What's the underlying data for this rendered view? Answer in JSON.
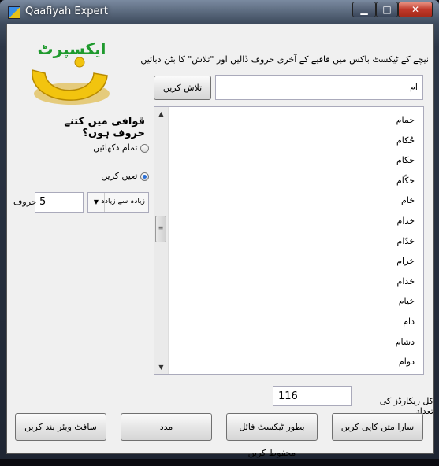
{
  "window": {
    "title": "Qaafiyah Expert",
    "controls": {
      "minimize": "▁",
      "maximize": "□",
      "close": "✕"
    }
  },
  "logo": {
    "text": "ایکسپرٹ",
    "colors": {
      "gold": "#f2c40f",
      "green": "#1f9a2e"
    }
  },
  "instruction": "نیچے کے ٹیکسٹ باکس میں قافیے کے آخری حروف ڈالیں اور \"تلاش\" کا بٹن دبائیں",
  "search": {
    "value": "ام",
    "button_label": "تلاش کریں"
  },
  "options": {
    "question": "قوافی میں کتنے حروف ہوں؟",
    "radio_all": {
      "label": "تمام دکھائیں",
      "checked": false
    },
    "radio_fixed": {
      "label": "تعین کریں",
      "checked": true
    },
    "dropdown_value": "زیادہ سے زیادہ",
    "count_value": "5",
    "count_unit": "حروف"
  },
  "results": {
    "items": [
      "حمام",
      "حُکام",
      "حکام",
      "حکّام",
      "خام",
      "خدام",
      "خدّام",
      "خرام",
      "خدام",
      "خیام",
      "دام",
      "دشام",
      "دوام"
    ]
  },
  "total": {
    "value": "116",
    "label": "کل ریکارڈز کی تعداد"
  },
  "buttons": {
    "copy_all": "سارا متن کاپی کریں",
    "save_text": "بطور ٹیکسٹ فائل محفوظ کریں",
    "help": "مدد",
    "close_app": "سافٹ ویئر بند کریں"
  }
}
